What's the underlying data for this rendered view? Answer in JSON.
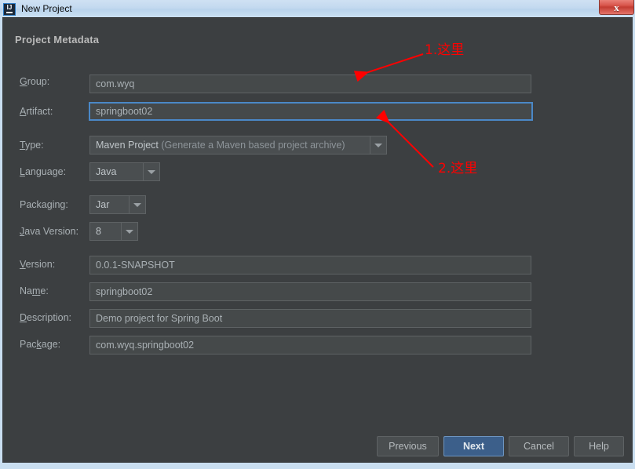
{
  "window": {
    "title": "New Project",
    "app_icon": "intellij-idea-icon",
    "close_label": "x"
  },
  "section": {
    "title": "Project Metadata"
  },
  "form": {
    "group": {
      "label_pre": "G",
      "label_mnemonic": "G",
      "label": "Group:",
      "value": "com.wyq"
    },
    "artifact": {
      "label": "Artifact:",
      "value": "springboot02",
      "focused": true
    },
    "type": {
      "label": "Type:",
      "value_main": "Maven Project",
      "value_detail": "(Generate a Maven based project archive)"
    },
    "language": {
      "label": "Language:",
      "value": "Java"
    },
    "packaging": {
      "label": "Packaging:",
      "value": "Jar"
    },
    "java_version": {
      "label": "Java Version:",
      "value": "8"
    },
    "version": {
      "label": "Version:",
      "value": "0.0.1-SNAPSHOT"
    },
    "name": {
      "label": "Name:",
      "value": "springboot02"
    },
    "description": {
      "label": "Description:",
      "value": "Demo project for Spring Boot"
    },
    "package": {
      "label": "Package:",
      "value": "com.wyq.springboot02"
    }
  },
  "annotations": [
    {
      "text": "1.这里",
      "color": "#ff0000"
    },
    {
      "text": "2.这里",
      "color": "#ff0000"
    }
  ],
  "footer": {
    "previous": "Previous",
    "next": "Next",
    "cancel": "Cancel",
    "help": "Help"
  },
  "colors": {
    "background": "#3c3f41",
    "field_background": "#45494a",
    "accent_focus": "#4a88c7",
    "primary_button": "#3c5f8a",
    "annotation": "#ff0000",
    "titlebar": "#c3d9ef"
  }
}
